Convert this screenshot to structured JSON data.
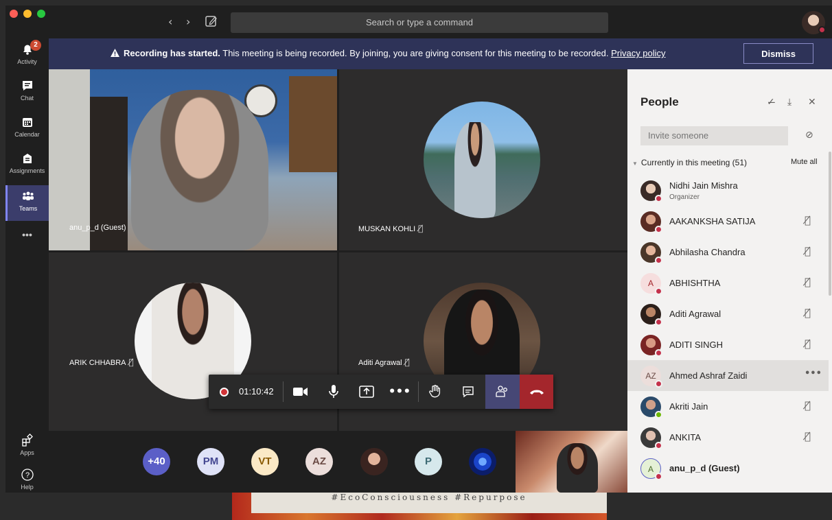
{
  "search": {
    "placeholder": "Search or type a command"
  },
  "rail": {
    "activity": {
      "label": "Activity",
      "badge": "2"
    },
    "chat": {
      "label": "Chat"
    },
    "calendar": {
      "label": "Calendar"
    },
    "assignments": {
      "label": "Assignments"
    },
    "teams": {
      "label": "Teams"
    },
    "more": {
      "label": "•••"
    },
    "apps": {
      "label": "Apps"
    },
    "help": {
      "label": "Help"
    }
  },
  "banner": {
    "bold": "Recording has started.",
    "text": " This meeting is being recorded. By joining, you are giving consent for this meeting to be recorded. ",
    "link": "Privacy policy",
    "dismiss": "Dismiss"
  },
  "tiles": {
    "t1": "anu_p_d (Guest)",
    "t2": "MUSKAN KOHLI",
    "t3": "ARIK CHHABRA",
    "t4": "Aditi Agrawal"
  },
  "controls": {
    "timer": "01:10:42"
  },
  "strip": [
    {
      "label": "+40",
      "bg": "#5b5fc7",
      "fg": "#ffffff"
    },
    {
      "label": "PM",
      "bg": "#dfe2f7",
      "fg": "#444791"
    },
    {
      "label": "VT",
      "bg": "#fbe9c6",
      "fg": "#8a5a00"
    },
    {
      "label": "AZ",
      "bg": "#ecdedb",
      "fg": "#6b4b45"
    },
    {
      "label": "",
      "bg": "#c58b7a",
      "fg": "#ffffff"
    },
    {
      "label": "P",
      "bg": "#d6e8ec",
      "fg": "#3e6b75"
    },
    {
      "label": "",
      "bg": "#0d2a8a",
      "fg": "#ffffff"
    }
  ],
  "panel": {
    "title": "People",
    "invite_placeholder": "Invite someone",
    "section": "Currently in this meeting (51)",
    "mute_all": "Mute all",
    "people": [
      {
        "name": "Nidhi Jain Mishra",
        "sub": "Organizer",
        "initials": "",
        "photo": true,
        "status": "busy",
        "mic": false,
        "more": false,
        "bold": false
      },
      {
        "name": "AAKANKSHA SATIJA",
        "sub": "",
        "initials": "",
        "photo": true,
        "status": "busy",
        "mic": true,
        "more": false,
        "bold": false
      },
      {
        "name": "Abhilasha Chandra",
        "sub": "",
        "initials": "",
        "photo": true,
        "status": "busy",
        "mic": true,
        "more": false,
        "bold": false
      },
      {
        "name": "ABHISHTHA",
        "sub": "",
        "initials": "A",
        "photo": false,
        "status": "busy",
        "mic": true,
        "more": false,
        "bold": false
      },
      {
        "name": "Aditi Agrawal",
        "sub": "",
        "initials": "",
        "photo": true,
        "status": "busy",
        "mic": true,
        "more": false,
        "bold": false
      },
      {
        "name": "ADITI SINGH",
        "sub": "",
        "initials": "",
        "photo": true,
        "status": "busy",
        "mic": true,
        "more": false,
        "bold": false
      },
      {
        "name": "Ahmed Ashraf Zaidi",
        "sub": "",
        "initials": "AZ",
        "photo": false,
        "status": "busy",
        "mic": false,
        "more": true,
        "bold": false
      },
      {
        "name": "Akriti Jain",
        "sub": "",
        "initials": "",
        "photo": true,
        "status": "available",
        "mic": true,
        "more": false,
        "bold": false
      },
      {
        "name": "ANKITA",
        "sub": "",
        "initials": "",
        "photo": true,
        "status": "busy",
        "mic": true,
        "more": false,
        "bold": false
      },
      {
        "name": "anu_p_d (Guest)",
        "sub": "",
        "initials": "A",
        "photo": false,
        "status": "busy",
        "mic": false,
        "more": false,
        "bold": true
      }
    ]
  },
  "below": {
    "text": "#EcoConsciousness #Repurpose"
  }
}
